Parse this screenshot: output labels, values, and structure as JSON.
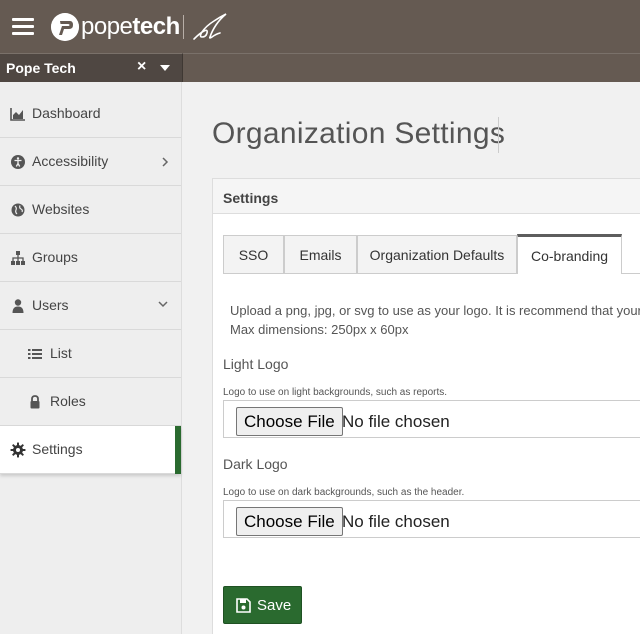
{
  "header": {
    "brand_prefix": "pope",
    "brand_suffix": "tech"
  },
  "org_selector": {
    "value": "Pope Tech",
    "clear_glyph": "×"
  },
  "sidebar": {
    "items": [
      {
        "label": "Dashboard",
        "icon": "area-chart-icon"
      },
      {
        "label": "Accessibility",
        "icon": "accessibility-icon",
        "chevron": "right"
      },
      {
        "label": "Websites",
        "icon": "globe-icon"
      },
      {
        "label": "Groups",
        "icon": "sitemap-icon"
      },
      {
        "label": "Users",
        "icon": "user-icon",
        "chevron": "down"
      },
      {
        "label": "List",
        "icon": "list-icon"
      },
      {
        "label": "Roles",
        "icon": "lock-icon"
      },
      {
        "label": "Settings",
        "icon": "gear-icon",
        "active": true
      }
    ]
  },
  "page": {
    "title": "Organization Settings"
  },
  "card": {
    "title": "Settings",
    "tabs": [
      {
        "label": "SSO"
      },
      {
        "label": "Emails"
      },
      {
        "label": "Organization Defaults"
      },
      {
        "label": "Co-branding",
        "active": true
      }
    ],
    "help_line1": "Upload a png, jpg, or svg to use as your logo. It is recommend that your",
    "help_line2": "Max dimensions: 250px x 60px",
    "light_logo": {
      "label": "Light Logo",
      "hint": "Logo to use on light backgrounds, such as reports.",
      "button": "Choose File",
      "status": "No file chosen"
    },
    "dark_logo": {
      "label": "Dark Logo",
      "hint": "Logo to use on dark backgrounds, such as the header.",
      "button": "Choose File",
      "status": "No file chosen"
    },
    "save_label": "Save"
  },
  "colors": {
    "header_bg": "#655a52",
    "accent_green": "#2a6a2f"
  }
}
